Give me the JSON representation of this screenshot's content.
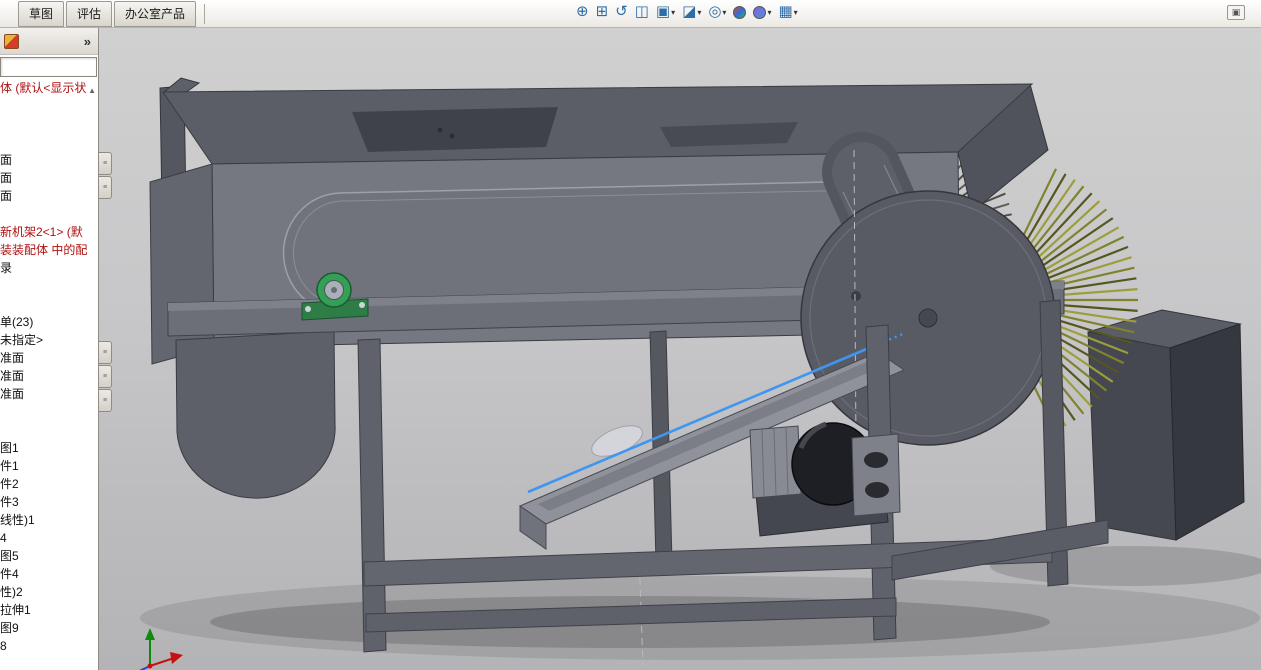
{
  "colors": {
    "selection-blue": "#3f96f0",
    "model-gray": "#6b6e77",
    "model-dark": "#565962",
    "model-light": "#8f929b",
    "brush-olive": "#81812e",
    "brush-olive-dark": "#565620",
    "brush-olive-light": "#9d9d3c",
    "dark-brush": "#4b4e44",
    "dark-brush-2": "#5b5e52",
    "bearing-green": "#33a055",
    "tree-error-red": "#b01010",
    "viewport-top": "#d0d0d0",
    "viewport-bottom": "#b4b4b7"
  },
  "top_bar": {
    "tabs": [
      {
        "label": "草图"
      },
      {
        "label": "评估"
      },
      {
        "label": "办公室产品"
      }
    ],
    "view_toolbar": [
      {
        "name": "zoom-to-fit",
        "glyph": "⊕"
      },
      {
        "name": "zoom-to-area",
        "glyph": "⊞"
      },
      {
        "name": "previous-view",
        "glyph": "↺"
      },
      {
        "name": "section-view",
        "glyph": "◫"
      },
      {
        "name": "view-orientation",
        "glyph": "▣",
        "dropdown": true
      },
      {
        "name": "display-style",
        "glyph": "◪",
        "dropdown": true
      },
      {
        "name": "hide-show-items",
        "glyph": "◎",
        "dropdown": true
      },
      {
        "name": "edit-appearance",
        "ball": [
          "#e04434",
          "#2f6de0",
          "#35b04a"
        ]
      },
      {
        "name": "apply-scene",
        "ball": [
          "#8a62d8",
          "#4a90d8"
        ],
        "dropdown": true
      },
      {
        "name": "view-settings",
        "glyph": "▦",
        "dropdown": true
      }
    ],
    "collapse_button_glyph": "▣"
  },
  "left_panel": {
    "expand_button": "»",
    "scroll_up_glyph": "▲",
    "filter_value": "",
    "tree_items": [
      {
        "label": "体 (默认<显示状",
        "red": true
      },
      {
        "label": ""
      },
      {
        "label": ""
      },
      {
        "label": ""
      },
      {
        "label": "面"
      },
      {
        "label": "面"
      },
      {
        "label": "面"
      },
      {
        "label": ""
      },
      {
        "label": "新机架2<1> (默",
        "red": true
      },
      {
        "label": "装装配体 中的配",
        "red": true
      },
      {
        "label": "录"
      },
      {
        "label": ""
      },
      {
        "label": ""
      },
      {
        "label": "单(23)"
      },
      {
        "label": "未指定>"
      },
      {
        "label": "准面"
      },
      {
        "label": "准面"
      },
      {
        "label": "准面"
      },
      {
        "label": ""
      },
      {
        "label": ""
      },
      {
        "label": "图1"
      },
      {
        "label": "件1"
      },
      {
        "label": "件2"
      },
      {
        "label": "件3"
      },
      {
        "label": "线性)1"
      },
      {
        "label": "4"
      },
      {
        "label": "图5"
      },
      {
        "label": "件4"
      },
      {
        "label": "性)2"
      },
      {
        "label": "拉伸1"
      },
      {
        "label": "图9"
      },
      {
        "label": "8"
      }
    ]
  }
}
